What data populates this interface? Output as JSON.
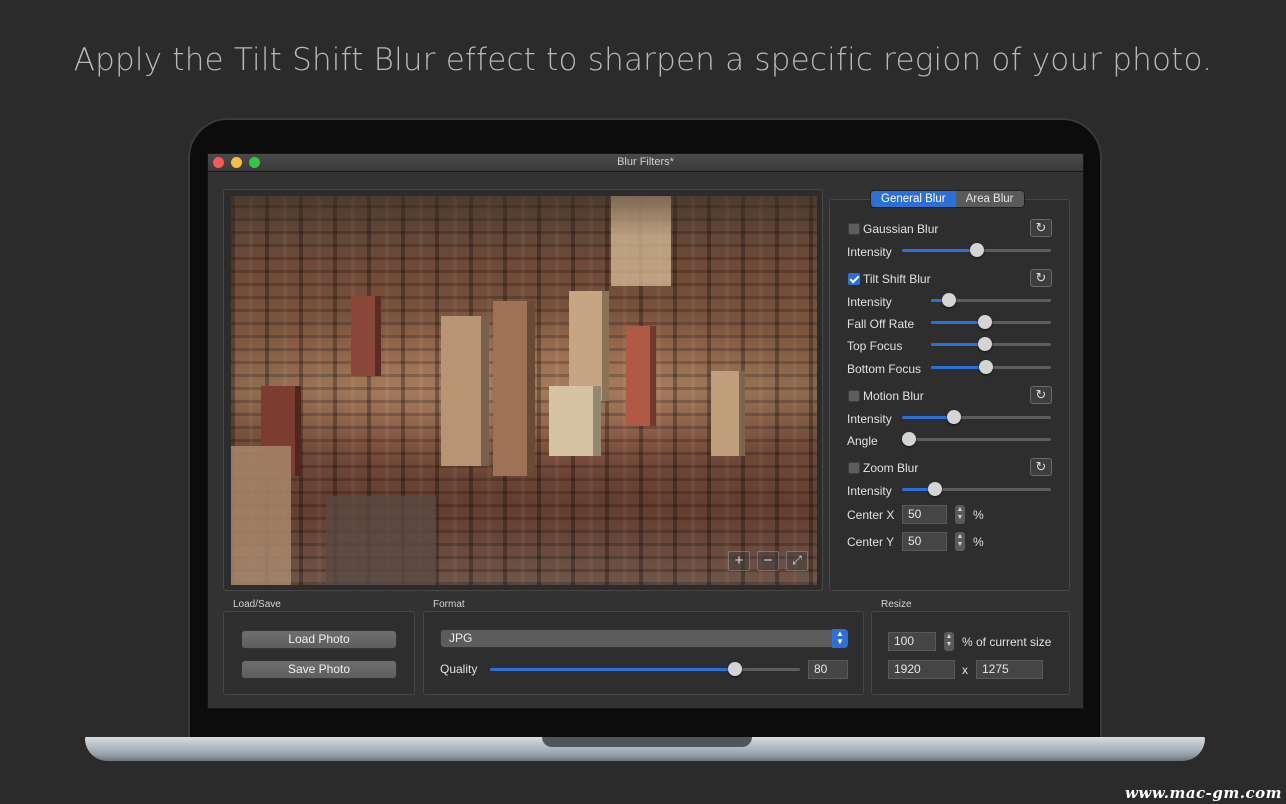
{
  "headline": "Apply the Tilt Shift Blur effect to sharpen a specific region of your photo.",
  "window": {
    "title": "Blur Filters*"
  },
  "tabs": [
    {
      "label": "General Blur",
      "active": true
    },
    {
      "label": "Area Blur",
      "active": false
    }
  ],
  "filters": {
    "gaussian": {
      "label": "Gaussian Blur",
      "checked": false,
      "intensity_label": "Intensity",
      "intensity": 0.5
    },
    "tilt_shift": {
      "label": "Tilt Shift Blur",
      "checked": true,
      "intensity_label": "Intensity",
      "intensity": 0.15,
      "falloff_label": "Fall Off Rate",
      "falloff": 0.45,
      "top_focus_label": "Top Focus",
      "top_focus": 0.45,
      "bottom_focus_label": "Bottom Focus",
      "bottom_focus": 0.46
    },
    "motion": {
      "label": "Motion Blur",
      "checked": false,
      "intensity_label": "Intensity",
      "intensity": 0.35,
      "angle_label": "Angle",
      "angle": 0.0
    },
    "zoom": {
      "label": "Zoom Blur",
      "checked": false,
      "intensity_label": "Intensity",
      "intensity": 0.22,
      "center_x_label": "Center X",
      "center_x": "50",
      "center_y_label": "Center Y",
      "center_y": "50",
      "unit": "%"
    }
  },
  "load_save": {
    "title": "Load/Save",
    "load_label": "Load Photo",
    "save_label": "Save Photo"
  },
  "format": {
    "title": "Format",
    "selected": "JPG",
    "quality_label": "Quality",
    "quality": "80",
    "quality_level": 0.79
  },
  "resize": {
    "title": "Resize",
    "percent": "100",
    "percent_label": "% of current size",
    "width": "1920",
    "x_label": "x",
    "height": "1275"
  },
  "zoom_controls": {
    "zoom_in_icon": "plus-icon",
    "zoom_out_icon": "minus-icon",
    "fit_icon": "expand-icon"
  },
  "watermark": "www.mac-gm.com",
  "colors": {
    "accent": "#2c6fd6",
    "background": "#2b2b2b"
  }
}
